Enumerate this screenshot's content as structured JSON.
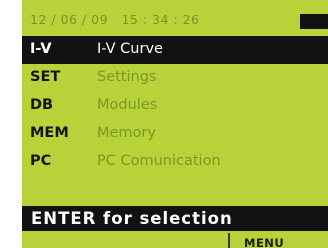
{
  "status": {
    "datetime": "12 / 06 / 09   15 : 34 : 26"
  },
  "menu": {
    "items": [
      {
        "key": "I-V",
        "label": "I-V Curve",
        "selected": true
      },
      {
        "key": "SET",
        "label": "Settings",
        "selected": false
      },
      {
        "key": "DB",
        "label": "Modules",
        "selected": false
      },
      {
        "key": "MEM",
        "label": "Memory",
        "selected": false
      },
      {
        "key": "PC",
        "label": "PC Comunication",
        "selected": false
      }
    ]
  },
  "hint": {
    "text": "ENTER for selection"
  },
  "softkeys": {
    "right_label": "MENU"
  },
  "colors": {
    "lcd_background": "#b8d33a",
    "selection_background": "#121212",
    "label_color": "#7c9624"
  }
}
